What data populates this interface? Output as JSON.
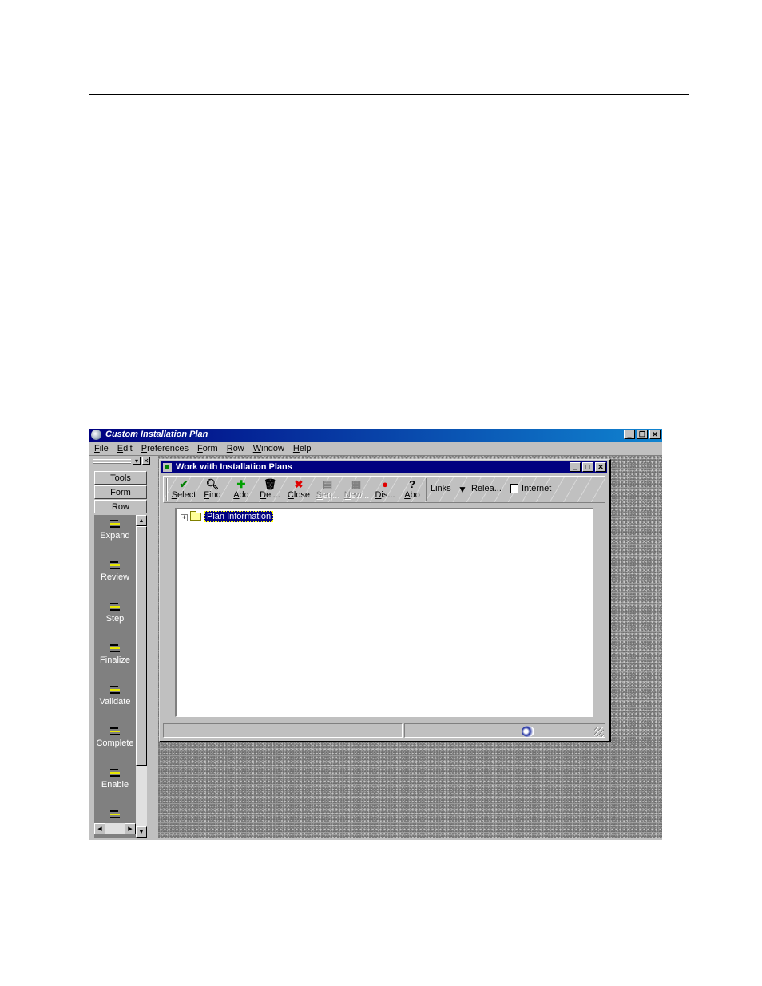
{
  "app": {
    "title": "Custom Installation Plan",
    "menu": [
      "File",
      "Edit",
      "Preferences",
      "Form",
      "Row",
      "Window",
      "Help"
    ]
  },
  "exit_bar": {
    "tabs": [
      "Tools",
      "Form",
      "Row"
    ],
    "items": [
      "Expand",
      "Review",
      "Step",
      "Finalize",
      "Validate",
      "Complete",
      "Enable"
    ]
  },
  "child": {
    "title": "Work with Installation Plans",
    "toolbar": [
      {
        "label": "Select",
        "icon": "checkmark-icon",
        "enabled": true
      },
      {
        "label": "Find",
        "icon": "find-icon",
        "enabled": true
      },
      {
        "label": "Add",
        "icon": "plus-icon",
        "enabled": true
      },
      {
        "label": "Del...",
        "icon": "trash-icon",
        "enabled": true
      },
      {
        "label": "Close",
        "icon": "x-icon",
        "enabled": true
      },
      {
        "label": "Seq...",
        "icon": "sequence-icon",
        "enabled": false
      },
      {
        "label": "New...",
        "icon": "new-icon",
        "enabled": false
      },
      {
        "label": "Dis...",
        "icon": "display-icon",
        "enabled": true
      },
      {
        "label": "Abo",
        "icon": "about-icon",
        "enabled": true
      }
    ],
    "links_label": "Links",
    "release_label": "Relea...",
    "internet_label": "Internet",
    "tree_node": "Plan Information"
  }
}
